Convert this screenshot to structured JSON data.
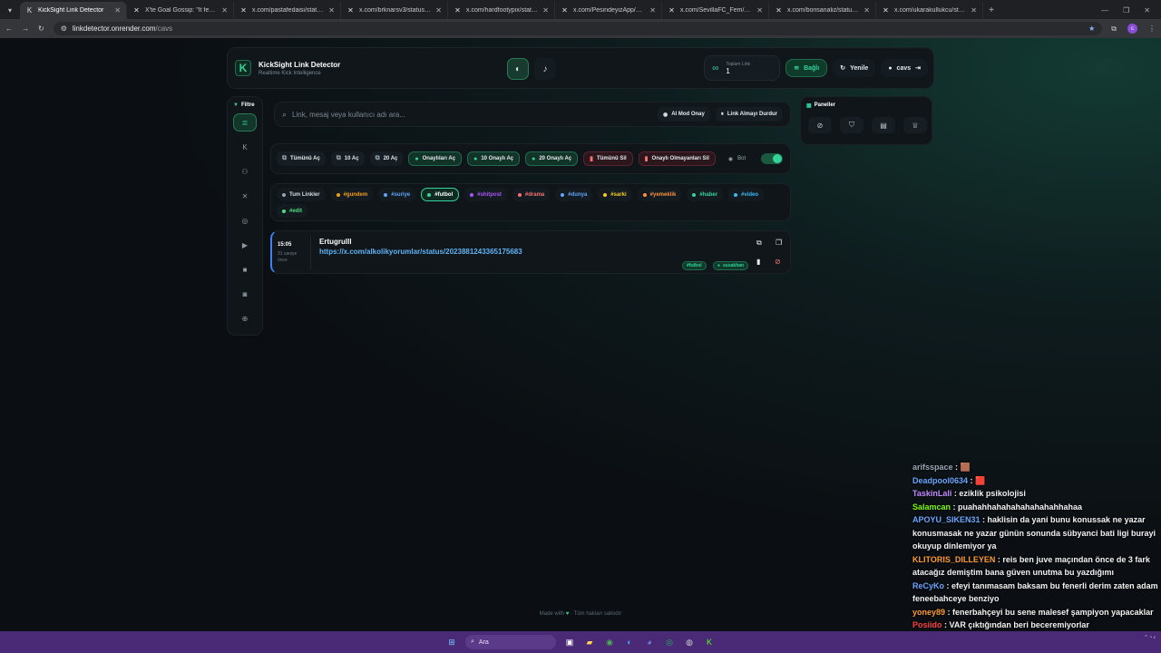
{
  "browser": {
    "tabs": [
      {
        "title": "KickSight Link Detector",
        "active": true
      },
      {
        "title": "X'te Goal Gossip: \"It feels like t",
        "active": false
      },
      {
        "title": "x.com/pastafedaisi/status/2023",
        "active": false
      },
      {
        "title": "x.com/brknarsv3/status/20238",
        "active": false
      },
      {
        "title": "x.com/hardfootypix/status/202",
        "active": false
      },
      {
        "title": "x.com/PesindeyizApp/status/20",
        "active": false
      },
      {
        "title": "x.com/SevillaFC_Fem/status/20",
        "active": false
      },
      {
        "title": "x.com/borisanaliz/status/20238",
        "active": false
      },
      {
        "title": "x.com/ukarakullukcu/status/20",
        "active": false
      }
    ],
    "address_host": "linkdetector.onrender.com",
    "address_path": "/cavs",
    "profile_initial": "c"
  },
  "header": {
    "title": "KickSight Link Detector",
    "subtitle": "Realtime Kick Intelligence",
    "stat_label": "Toplam Link",
    "stat_value": "1",
    "connected_label": "Bağlı",
    "refresh_label": "Yenile",
    "user_label": "cavs"
  },
  "sidebar": {
    "title": "Filtre",
    "items": [
      {
        "name": "list",
        "icon": "≣",
        "active": true
      },
      {
        "name": "kick",
        "icon": "K",
        "active": false
      },
      {
        "name": "users",
        "icon": "⚇",
        "active": false
      },
      {
        "name": "x",
        "icon": "✕",
        "active": false
      },
      {
        "name": "instagram",
        "icon": "◎",
        "active": false
      },
      {
        "name": "youtube",
        "icon": "▶",
        "active": false
      },
      {
        "name": "video",
        "icon": "■",
        "active": false
      },
      {
        "name": "camera",
        "icon": "◙",
        "active": false
      },
      {
        "name": "globe",
        "icon": "⊕",
        "active": false
      }
    ]
  },
  "search": {
    "placeholder": "Link, mesaj veya kullanıcı adı ara...",
    "ai_mode": "AI Mod Onay",
    "stop_label": "Link Almayı Durdur"
  },
  "actions": {
    "open_all": "Tümünü Aç",
    "open_10": "10 Aç",
    "open_20": "20 Aç",
    "open_approved": "Onaylıları Aç",
    "open_10_approved": "10 Onaylı Aç",
    "open_20_approved": "20 Onaylı Aç",
    "delete_all": "Tümünü Sil",
    "delete_unapproved": "Onaylı Olmayanları Sil",
    "bot_label": "Bot"
  },
  "panels": {
    "title": "Paneller"
  },
  "tags": [
    {
      "label": "Tum Linkler",
      "color": "#9ca3af",
      "active": false
    },
    {
      "label": "#gundem",
      "color": "#f59e0b",
      "active": false
    },
    {
      "label": "#suriye",
      "color": "#60a5fa",
      "active": false
    },
    {
      "label": "#futbol",
      "color": "#34d399",
      "active": true
    },
    {
      "label": "#shitpost",
      "color": "#a855f7",
      "active": false
    },
    {
      "label": "#drama",
      "color": "#f87171",
      "active": false
    },
    {
      "label": "#dunya",
      "color": "#60a5fa",
      "active": false
    },
    {
      "label": "#sarki",
      "color": "#facc15",
      "active": false
    },
    {
      "label": "#yemeklik",
      "color": "#fb923c",
      "active": false
    },
    {
      "label": "#haber",
      "color": "#34d399",
      "active": false
    },
    {
      "label": "#video",
      "color": "#38bdf8",
      "active": false
    },
    {
      "label": "#edit",
      "color": "#4ade80",
      "active": false
    }
  ],
  "card": {
    "time": "15:05",
    "ago": "31 saniye önce",
    "user": "Ertugrulll",
    "link": "https://x.com/alkolikyorumlar/status/2023881243365175683",
    "chip_tag": "#futbol",
    "chip_status": "susakhan"
  },
  "footer": {
    "made_with": "Made with",
    "rights": "· Tüm hakları saklıdır"
  },
  "chat": [
    {
      "user": "arifsspace",
      "color": "#9aa7b4",
      "msg": "🟫"
    },
    {
      "user": "Deadpool0634",
      "color": "#6aa6ff",
      "msg": "🟥"
    },
    {
      "user": "TaskinLali",
      "color": "#c38bff",
      "msg": "eziklik psikolojisi"
    },
    {
      "user": "Salamcan",
      "color": "#7cfc00",
      "msg": "puahahhahahahahahahahhahaa"
    },
    {
      "user": "APOYU_SIKEN31",
      "color": "#6aa6ff",
      "msg": "haklisin da yani bunu konussak ne yazar konusmasak ne yazar günün sonunda sübyanci bati ligi burayi okuyup dinlemiyor ya"
    },
    {
      "user": "KLITORIS_DILLEYEN",
      "color": "#ff9c2e",
      "msg": "reis ben juve maçından önce de 3 fark atacağız demiştim bana güven unutma bu yazdığımı"
    },
    {
      "user": "ReCyKo",
      "color": "#6aa6ff",
      "msg": "efeyi tanımasam baksam bu fenerli derim zaten adam feneebahceye benziyo"
    },
    {
      "user": "yoney89",
      "color": "#ff9c2e",
      "msg": "fenerbahçeyi bu sene malesef şampiyon yapacaklar"
    },
    {
      "user": "Posiido",
      "color": "#ff4040",
      "msg": "VAR çıktığından beri beceremiyorlar"
    }
  ],
  "taskbar": {
    "search_label": "Ara"
  }
}
